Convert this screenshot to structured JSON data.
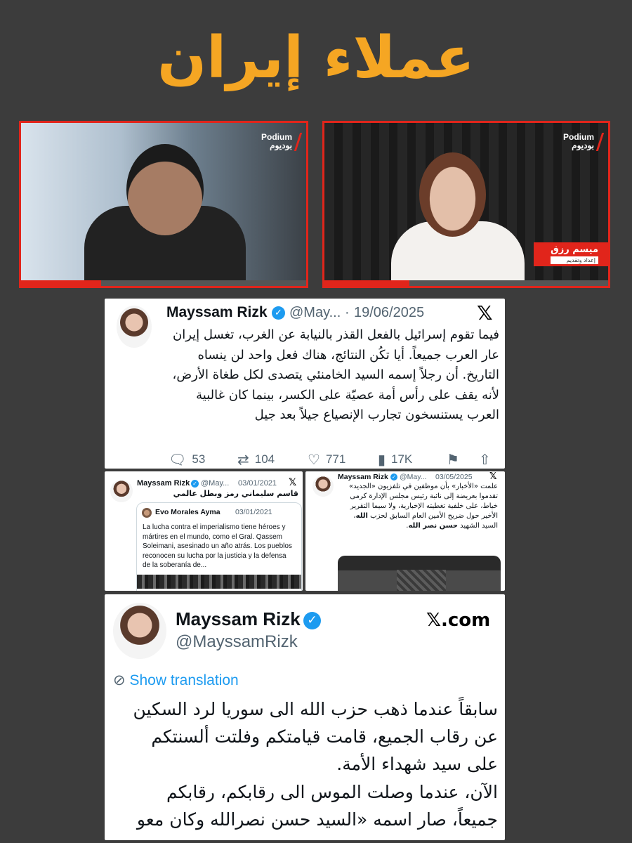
{
  "banner": {
    "title": "عملاء إيران",
    "color": "#f5a623"
  },
  "videos": {
    "left": {
      "logo_en": "Podium",
      "logo_ar": "بوديوم",
      "progress": 0.28
    },
    "right": {
      "logo_en": "Podium",
      "logo_ar": "بوديوم",
      "lower_third_name": "ميسم رزق",
      "lower_third_sub": "إعداد وتقديم",
      "progress": 0.3
    }
  },
  "main_tweet": {
    "name": "Mayssam Rizk",
    "handle": "@May...",
    "date": "19/06/2025",
    "x_icon": "x-logo-icon",
    "text": "فيما تقوم إسرائيل بالفعل القذر بالنيابة عن الغرب، تغسل إيران عار العرب جميعاً. أيا تكُن النتائج، هناك فعل واحد لن ينساه التاريخ. أن رجلاً إسمه السيد الخامنئي يتصدى لكل طغاة الأرض، لأنه يقف على رأس أمة عصيّة على الكسر، بينما كان غالبية العرب يستنسخون تجارب الإنصياع جيلاً بعد جيل",
    "stats": {
      "replies": "53",
      "retweets": "104",
      "likes": "771",
      "views": "17K"
    }
  },
  "mid_left_tweet": {
    "name": "Mayssam Rizk",
    "handle": "@May...",
    "date": "03/01/2021",
    "text": "قاسم سليماني رمز وبطل عالمي",
    "quoted": {
      "name": "Evo Morales Ayma",
      "date": "03/01/2021",
      "text": "La lucha contra el imperialismo tiene héroes y mártires en el mundo, como el Gral. Qassem Soleimani, asesinado un año atrás. Los pueblos reconocen su lucha por la justicia y la defensa de la soberanía de..."
    }
  },
  "mid_right_tweet": {
    "name": "Mayssam Rizk",
    "handle": "@May...",
    "date": "03/05/2025",
    "text_a": "علمت «الأخبار» بأن موظفين في تلفزيون «الجديد» تقدموا بعريضة إلى نائبة رئيس مجلس الإدارة كرمى خياط، على خلفية تغطيته الإخبارية، ولا سيما التقرير الأخير حول ضريح الأمين العام السابق لحزب ",
    "text_bold1": "الله",
    "text_b": "، السيد الشهيد ",
    "text_bold2": "حسن نصر الله",
    "text_c": "."
  },
  "bottom_tweet": {
    "name": "Mayssam Rizk",
    "handle": "@MayssamRizk",
    "brand": "𝕏.com",
    "translate_label": "Show translation",
    "paragraph1": "سابقاً عندما ذهب حزب الله الى سوريا لرد السكين عن رقاب الجميع، قامت قيامتكم وفلتت ألسنتكم على سيد شهداء الأمة.",
    "paragraph2": "الآن، عندما وصلت الموس الى رقابكم، رقابكم جميعاً، صار اسمه «السيد حسن نصرالله وكان معو حق»"
  }
}
